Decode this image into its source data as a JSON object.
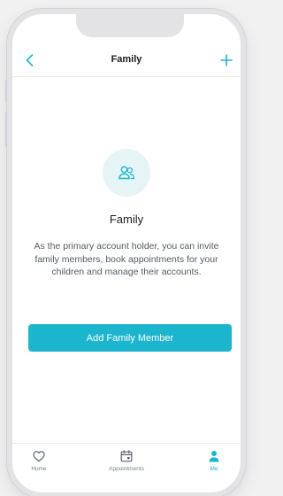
{
  "header": {
    "title": "Family"
  },
  "content": {
    "heading": "Family",
    "description": "As the primary account holder, you can invite family members, book appointments for your children and manage their accounts.",
    "cta_label": "Add Family Member"
  },
  "icons": {
    "back": "chevron-left-icon",
    "add": "plus-icon",
    "hero": "family-users-icon",
    "home": "heart-icon",
    "appointments": "calendar-icon",
    "me": "person-icon"
  },
  "tabbar": {
    "items": [
      {
        "label": "Home",
        "active": false
      },
      {
        "label": "Appointments",
        "active": false
      },
      {
        "label": "Me",
        "active": true
      }
    ]
  },
  "colors": {
    "accent": "#1bb5cd",
    "icon_bg": "#e7f4f6",
    "text_primary": "#1c1c1c",
    "text_secondary": "#555b61",
    "tab_inactive": "#7a7f85"
  }
}
